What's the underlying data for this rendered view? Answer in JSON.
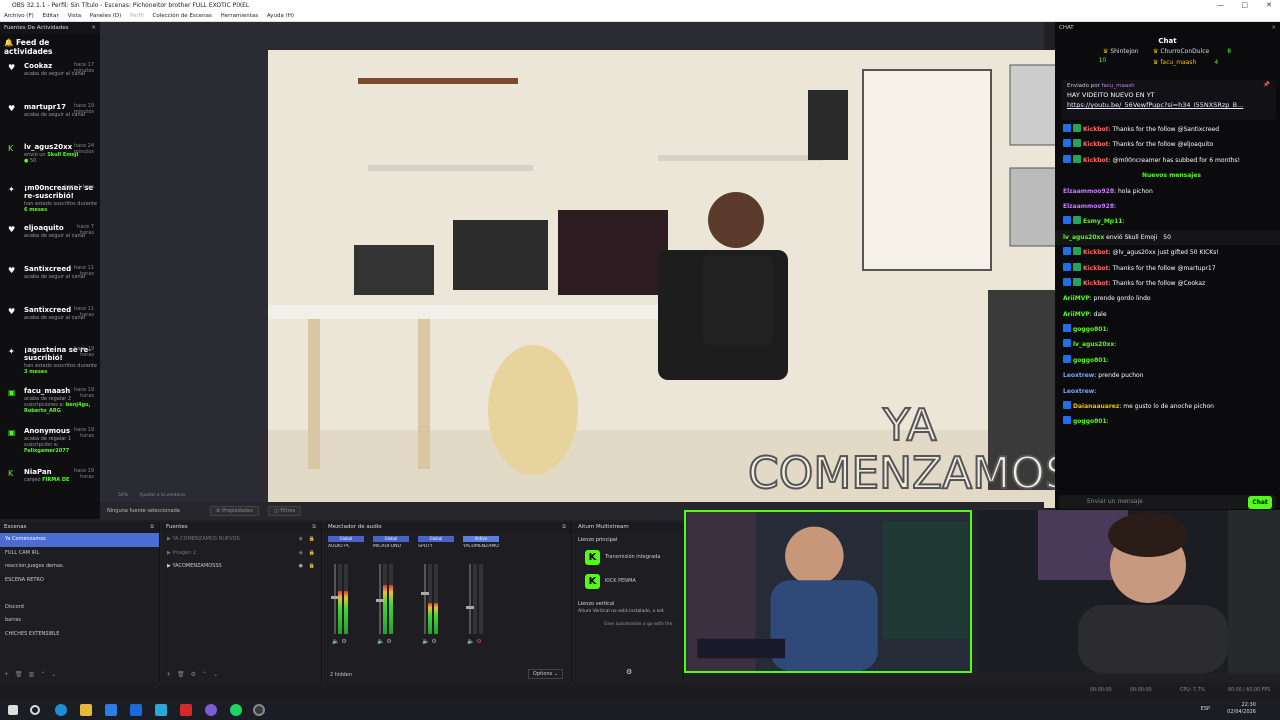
{
  "window": {
    "title": "OBS 32.1.1 - Perfil: Sin Título - Escenas: Pichoneitor brother FULL EXOTIC PIXEL",
    "controls": [
      "—",
      "□",
      "✕"
    ]
  },
  "menu": [
    "Archivo (F)",
    "Editar",
    "Vista",
    "Paneles (D)",
    "Perfil",
    "Colección de Escenas",
    "Herramientas",
    "Ayuda (H)"
  ],
  "feed": {
    "dock_title": "Fuentes De Actividades",
    "title": "Feed de actividades",
    "items": [
      {
        "icon": "heart-icon",
        "name": "Cookaz",
        "action": "acaba de seguir al canal",
        "time": "hace 17 minutos",
        "extra": ""
      },
      {
        "icon": "heart-icon",
        "name": "martupr17",
        "action": "acaba de seguir al canal",
        "time": "hace 19 minutos",
        "extra": ""
      },
      {
        "icon": "kick-icon",
        "name": "lv_agus20xx",
        "action": "envió un",
        "time": "hace 24 minutos",
        "extra": "Skull Emoji",
        "amount": "50"
      },
      {
        "icon": "star-icon",
        "name": "¡m00ncreamer se re-suscribió!",
        "action": "han estado suscritos durante",
        "time": "hace 1 hora",
        "extra": "6 meses"
      },
      {
        "icon": "heart-icon",
        "name": "eljoaquito",
        "action": "acaba de seguir al canal",
        "time": "hace 7 horas",
        "extra": ""
      },
      {
        "icon": "heart-icon",
        "name": "Santixcreed",
        "action": "acaba de seguir al canal",
        "time": "hace 11 horas",
        "extra": ""
      },
      {
        "icon": "heart-icon",
        "name": "Santixcreed",
        "action": "acaba de seguir al canal",
        "time": "hace 11 horas",
        "extra": ""
      },
      {
        "icon": "star-icon",
        "name": "¡agusteina se re-suscribió!",
        "action": "han estado suscritos durante",
        "time": "hace 19 horas",
        "extra": "3 meses"
      },
      {
        "icon": "gift-icon",
        "name": "facu_maash",
        "action": "acaba de regalar 2 suscripciones a:",
        "time": "hace 19 horas",
        "extra": "benj4gu, Roberto_ARG"
      },
      {
        "icon": "gift-icon",
        "name": "Anonymous",
        "action": "acaba de regalar 1 suscripción a:",
        "time": "hace 19 horas",
        "extra": "Felixgamer2077"
      },
      {
        "icon": "kick-icon",
        "name": "NiaPan",
        "action": "canjeó",
        "time": "hace 19 horas",
        "extra": "FIRMA DE"
      }
    ]
  },
  "preview": {
    "zoom": "54%",
    "fit": "Ajustar a la ventana",
    "overlay_line1": "YA",
    "overlay_line2": "COMENZAMOS"
  },
  "props": {
    "no_source": "Ninguna fuente seleccionada",
    "properties": "Propiedades",
    "filters": "Filtros"
  },
  "chat": {
    "dock_title": "CHAT",
    "title": "Chat",
    "top_supporters": [
      {
        "name": "Shintejon",
        "amount": "10"
      },
      {
        "name": "ChurroConDulce",
        "amount": "8"
      },
      {
        "name": "facu_maash",
        "amount": "4"
      }
    ],
    "pinned": {
      "by_label": "Enviado por",
      "by_user": "facu_maash",
      "text": "HAY VIDEITO NUEVO EN YT",
      "link": "https://youtu.be/_56VewfPupc?si=h34_I55NXSRzp_B..."
    },
    "messages": [
      {
        "user": "Kickbot",
        "color": "red",
        "text": "Thanks for the follow @Santixcreed",
        "badges": 2
      },
      {
        "user": "Kickbot",
        "color": "red",
        "text": "Thanks for the follow @eljoaquito",
        "badges": 2
      },
      {
        "user": "Kickbot",
        "color": "red",
        "text": "@m00ncreamer has subbed for 6 months!",
        "badges": 2
      },
      {
        "type": "sep",
        "text": "Nuevos mensajes"
      },
      {
        "user": "Elzaammoo928",
        "color": "pink",
        "text": "hola pichon",
        "badges": 0
      },
      {
        "user": "Elzaammoo928",
        "color": "pink",
        "text": "",
        "badges": 0
      },
      {
        "user": "Esmy_Mp11",
        "color": "green",
        "text": "",
        "badges": 2
      },
      {
        "type": "gift",
        "user": "lv_agus20xx",
        "text": "envió Skull Emoji",
        "amount": "50"
      },
      {
        "user": "Kickbot",
        "color": "red",
        "text": "@lv_agus20xx just gifted 50 KICKs!",
        "badges": 2
      },
      {
        "user": "Kickbot",
        "color": "red",
        "text": "Thanks for the follow @martupr17",
        "badges": 2
      },
      {
        "user": "Kickbot",
        "color": "red",
        "text": "Thanks for the follow @Cookaz",
        "badges": 2
      },
      {
        "user": "AriiMVP",
        "color": "green",
        "text": "prende gordo lindo",
        "badges": 0
      },
      {
        "user": "AriiMVP",
        "color": "green",
        "text": "dale",
        "badges": 0
      },
      {
        "user": "goggo801",
        "color": "green",
        "text": "",
        "badges": 1
      },
      {
        "user": "lv_agus20xx",
        "color": "green",
        "text": "",
        "badges": 1
      },
      {
        "user": "goggo801",
        "color": "green",
        "text": "",
        "badges": 1
      },
      {
        "user": "Leoxtrew",
        "color": "blue",
        "text": "prende puchon",
        "badges": 0
      },
      {
        "user": "Leoxtrew",
        "color": "blue",
        "text": "",
        "badges": 0
      },
      {
        "user": "Daianaauarez",
        "color": "yellow",
        "text": "me gusto lo de anoche pichon",
        "badges": 1
      },
      {
        "user": "goggo801",
        "color": "green",
        "text": "",
        "badges": 1
      }
    ],
    "input_placeholder": "Enviar un mensaje",
    "send": "Chat"
  },
  "scenes": {
    "title": "Escenas",
    "items": [
      "Ya Comenzamos",
      "FULL CAM IRL",
      "reaccion,juegos demas.",
      "ESCENA RETRO",
      "",
      "Discord",
      "barras",
      "CHICHES EXTENSIBLE"
    ],
    "selected": 0
  },
  "sources": {
    "title": "Fuentes",
    "items": [
      {
        "name": "YA COMENZAMOS NUEVOS",
        "dim": true
      },
      {
        "name": "Imagen 2",
        "dim": true
      },
      {
        "name": "YACOMENZAMOSSS",
        "dim": false
      }
    ]
  },
  "mixer": {
    "title": "Mezclador de audio",
    "footer": "2 hidden",
    "options": "Options",
    "channels": [
      {
        "tag": "Global",
        "name": "AUDIO PC",
        "level": 0.62,
        "vol": 0.55
      },
      {
        "tag": "Global",
        "name": "MICROFONO",
        "level": 0.7,
        "vol": 0.5
      },
      {
        "tag": "Global",
        "name": "SPOTY",
        "level": 0.45,
        "vol": 0.6
      },
      {
        "tag": "Active",
        "name": "YACOMENZAMOSSS",
        "level": 0.0,
        "vol": 0.4
      }
    ]
  },
  "multistream": {
    "title": "Aitum Multistream",
    "main": "Lienzo principal",
    "outputs": [
      "Transmisión integrada",
      "KICK PENMA"
    ],
    "vertical": "Lienzo vertical",
    "vertical_msg": "Aitum Vertical no está instalado, o est",
    "automation": "Give automation a go with the"
  },
  "status": {
    "timer1": "00:00:00",
    "timer2": "00:00:00",
    "cpu": "CPU: 7.7%",
    "fps": "60.00 / 60.00 FPS"
  },
  "taskbar": {
    "lang": "ESP",
    "time": "22:30",
    "date": "02/04/2026"
  }
}
